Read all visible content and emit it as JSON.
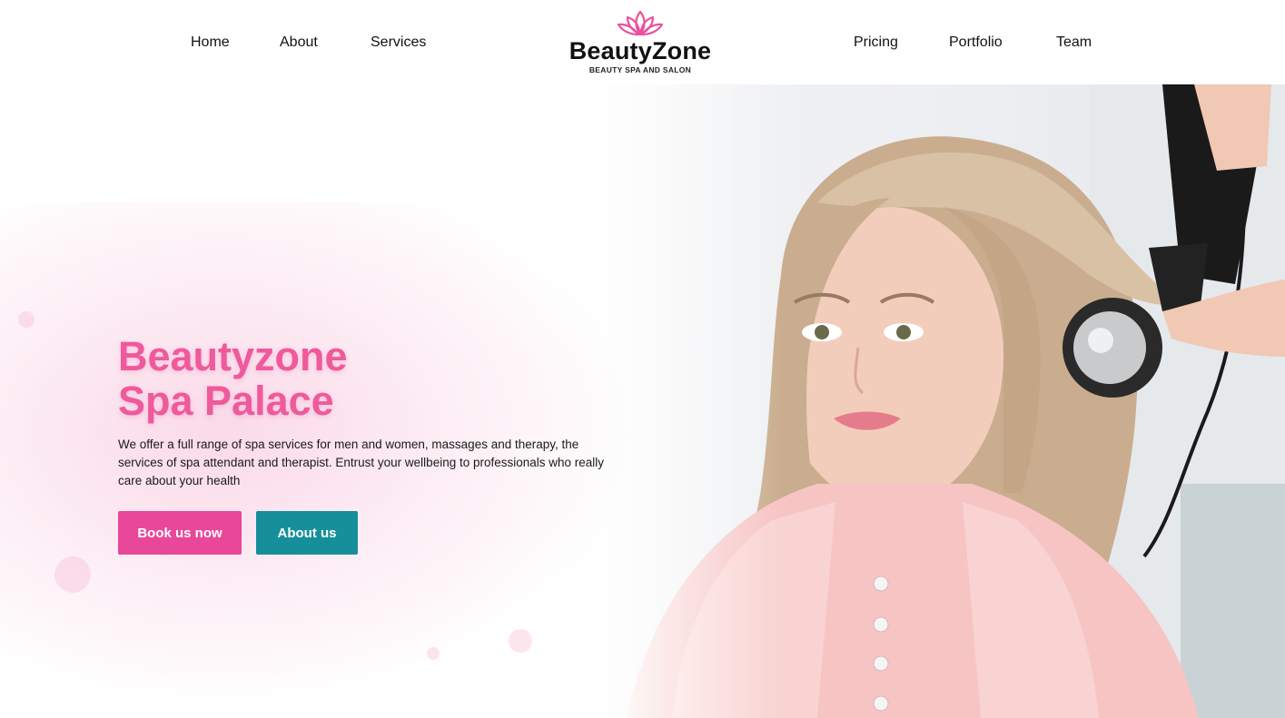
{
  "nav": {
    "left": [
      "Home",
      "About",
      "Services"
    ],
    "right": [
      "Pricing",
      "Portfolio",
      "Team"
    ]
  },
  "logo": {
    "name": "BeautyZone",
    "tagline": "BEAUTY SPA AND SALON",
    "icon": "lotus-icon",
    "icon_color": "#ec4f9d"
  },
  "hero": {
    "title_line1": "Beautyzone",
    "title_line2": "Spa Palace",
    "description": "We offer a full range of spa services for men and women, massages and therapy, the services of spa attendant and therapist. Entrust your wellbeing to professionals who really care about your health",
    "primary_button": "Book us now",
    "secondary_button": "About us",
    "image": "woman-hair-styling-photo"
  },
  "colors": {
    "accent_pink": "#ef5a9c",
    "button_pink": "#e8479a",
    "button_teal": "#178f9a"
  }
}
